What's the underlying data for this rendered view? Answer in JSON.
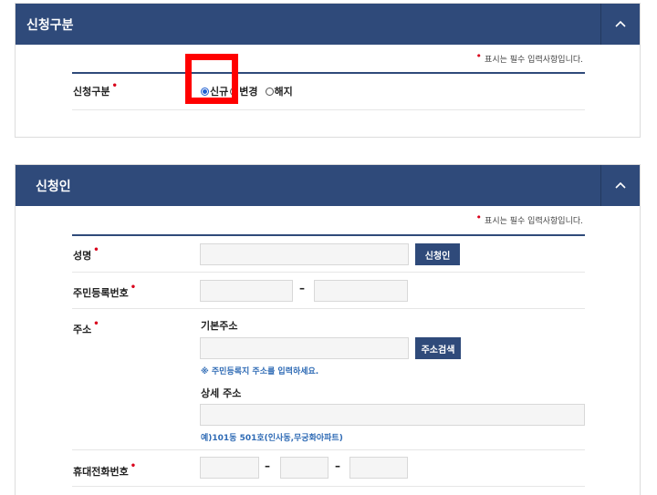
{
  "section1": {
    "title": "신청구분",
    "required_note": "표시는 필수 입력사항입니다.",
    "field_label": "신청구분",
    "radio_options": [
      {
        "label": "신규",
        "checked": true
      },
      {
        "label": "변경",
        "checked": false
      },
      {
        "label": "해지",
        "checked": false
      }
    ]
  },
  "section2": {
    "title": "신청인",
    "required_note": "표시는 필수 입력사항입니다.",
    "name_label": "성명",
    "name_button": "신청인",
    "rrn_label": "주민등록번호",
    "rrn_separator": "–",
    "address_label": "주소",
    "basic_address_label": "기본주소",
    "address_search_button": "주소검색",
    "address_hint": "※ 주민등록지 주소를 입력하세요.",
    "detail_address_label": "상세 주소",
    "detail_address_hint": "예)101동 501호(인사동,무궁화아파트)",
    "mobile_label": "휴대전화번호",
    "mobile_separator": "–"
  },
  "colors": {
    "header": "#2f4a7a",
    "required_dot": "#d9001b",
    "hint_text": "#2f6bb5",
    "highlight": "#ff0000"
  },
  "icons": {
    "collapse": "chevron-up-icon"
  }
}
